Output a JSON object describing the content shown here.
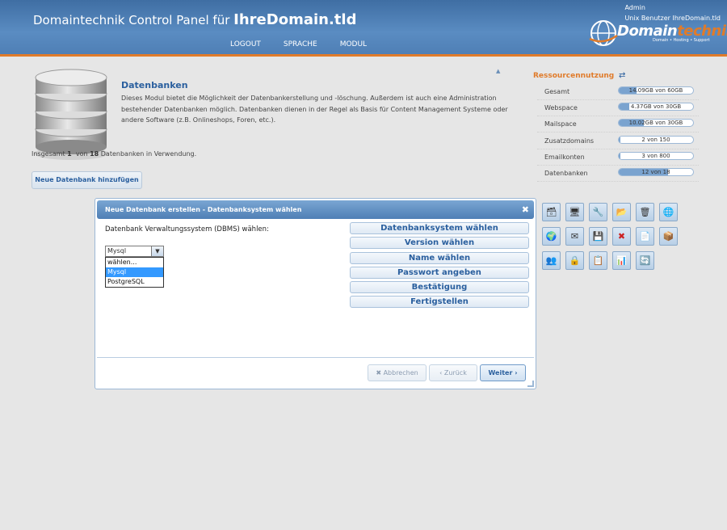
{
  "header": {
    "title_prefix": "Domaintechnik Control Panel für",
    "title_domain": "IhreDomain.tld",
    "nav": [
      "LOGOUT",
      "SPRACHE",
      "MODUL"
    ],
    "user": "Admin",
    "unix_user": "Unix Benutzer IhreDomain.tld",
    "logo_brand_a": "Domain",
    "logo_brand_b": "technik",
    "logo_sub": "Domain • Hosting • Support"
  },
  "module": {
    "title": "Datenbanken",
    "description": "Dieses Modul bietet die Möglichkeit der Datenbankerstellung und -löschung. Außerdem ist auch eine Administration bestehender Datenbanken möglich. Datenbanken dienen in der Regel als Basis für Content Management Systeme oder andere Software (z.B. Onlineshops, Foren, etc.).",
    "usage_prefix": "Insgesamt",
    "usage_used": "1",
    "usage_mid": "von",
    "usage_total": "18",
    "usage_suffix": "Datenbanken in Verwendung.",
    "add_button": "Neue Datenbank hinzufügen"
  },
  "resources": {
    "title": "Ressourcennutzung",
    "items": [
      {
        "label": "Gesamt",
        "value": "14.09GB von 60GB",
        "fraction": 0.235
      },
      {
        "label": "Webspace",
        "value": "4.37GB von 30GB",
        "fraction": 0.146
      },
      {
        "label": "Mailspace",
        "value": "10.02GB von 30GB",
        "fraction": 0.334
      },
      {
        "label": "Zusatzdomains",
        "value": "2 von 150",
        "fraction": 0.013
      },
      {
        "label": "Emailkonten",
        "value": "3 von 800",
        "fraction": 0.004
      },
      {
        "label": "Datenbanken",
        "value": "12 von 18",
        "fraction": 0.667
      }
    ]
  },
  "dialog": {
    "title": "Neue Datenbank erstellen - Datenbanksystem wählen",
    "field_label": "Datenbank Verwaltungssystem (DBMS) wählen:",
    "selected": "Mysql",
    "options": [
      "wählen...",
      "Mysql",
      "PostgreSQL"
    ],
    "steps": [
      "Datenbanksystem wählen",
      "Version wählen",
      "Name wählen",
      "Passwort angeben",
      "Bestätigung",
      "Fertigstellen"
    ],
    "cancel": "Abbrechen",
    "back": "Zurück",
    "next": "Weiter"
  },
  "colors": {
    "header_blue": "#4f7fb5",
    "accent_orange": "#e07b2a",
    "link_blue": "#2a5f9e",
    "selection": "#3399ff"
  }
}
